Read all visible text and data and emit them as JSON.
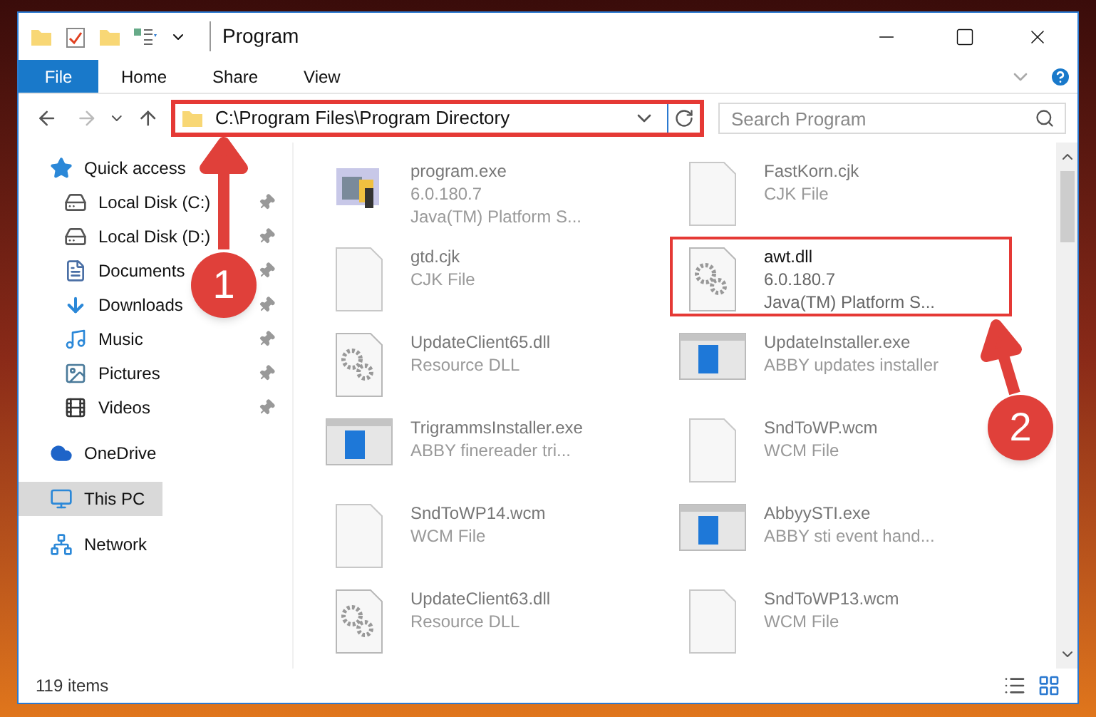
{
  "window": {
    "title": "Program"
  },
  "ribbon": {
    "tabs": [
      {
        "label": "File",
        "selected": true
      },
      {
        "label": "Home",
        "selected": false
      },
      {
        "label": "Share",
        "selected": false
      },
      {
        "label": "View",
        "selected": false
      }
    ]
  },
  "address_bar": {
    "path": "C:\\Program Files\\Program Directory",
    "highlighted": true
  },
  "search": {
    "placeholder": "Search Program"
  },
  "sidebar": {
    "items": [
      {
        "label": "Quick access",
        "kind": "star",
        "selected": false,
        "children": [
          {
            "label": "Local Disk (C:)",
            "kind": "drive",
            "pinned": true,
            "selected": false
          },
          {
            "label": "Local Disk (D:)",
            "kind": "drive",
            "pinned": true,
            "selected": false
          },
          {
            "label": "Documents",
            "kind": "document",
            "pinned": true,
            "selected": false
          },
          {
            "label": "Downloads",
            "kind": "download",
            "pinned": true,
            "selected": false
          },
          {
            "label": "Music",
            "kind": "music",
            "pinned": true,
            "selected": false
          },
          {
            "label": "Pictures",
            "kind": "pictures",
            "pinned": true,
            "selected": false
          },
          {
            "label": "Videos",
            "kind": "videos",
            "pinned": true,
            "selected": false
          }
        ]
      },
      {
        "label": "OneDrive",
        "kind": "cloud",
        "selected": false
      },
      {
        "label": "This PC",
        "kind": "pc",
        "selected": true
      },
      {
        "label": "Network",
        "kind": "network",
        "selected": false
      }
    ]
  },
  "files": [
    {
      "name": "program.exe",
      "lines": [
        "6.0.180.7",
        "Java(TM) Platform S..."
      ],
      "kind": "app",
      "highlighted": false
    },
    {
      "name": "FastKorn.cjk",
      "lines": [
        "CJK File"
      ],
      "kind": "blank",
      "highlighted": false
    },
    {
      "name": "gtd.cjk",
      "lines": [
        "CJK File"
      ],
      "kind": "blank",
      "highlighted": false
    },
    {
      "name": "awt.dll",
      "lines": [
        "6.0.180.7",
        "Java(TM) Platform S..."
      ],
      "kind": "gear",
      "highlighted": true
    },
    {
      "name": "UpdateClient65.dll",
      "lines": [
        "Resource DLL"
      ],
      "kind": "gear",
      "highlighted": false
    },
    {
      "name": "UpdateInstaller.exe",
      "lines": [
        "ABBY updates installer"
      ],
      "kind": "installer",
      "highlighted": false
    },
    {
      "name": "TrigrammsInstaller.exe",
      "lines": [
        "ABBY finereader tri..."
      ],
      "kind": "installer",
      "highlighted": false
    },
    {
      "name": "SndToWP.wcm",
      "lines": [
        "WCM File"
      ],
      "kind": "blank",
      "highlighted": false
    },
    {
      "name": "SndToWP14.wcm",
      "lines": [
        "WCM File"
      ],
      "kind": "blank",
      "highlighted": false
    },
    {
      "name": "AbbyySTI.exe",
      "lines": [
        "ABBY sti event hand..."
      ],
      "kind": "installer",
      "highlighted": false
    },
    {
      "name": "UpdateClient63.dll",
      "lines": [
        "Resource DLL"
      ],
      "kind": "gear",
      "highlighted": false
    },
    {
      "name": "SndToWP13.wcm",
      "lines": [
        "WCM File"
      ],
      "kind": "blank",
      "highlighted": false
    }
  ],
  "status_bar": {
    "count": "119 items"
  },
  "annotations": [
    {
      "label": "1"
    },
    {
      "label": "2"
    }
  ]
}
